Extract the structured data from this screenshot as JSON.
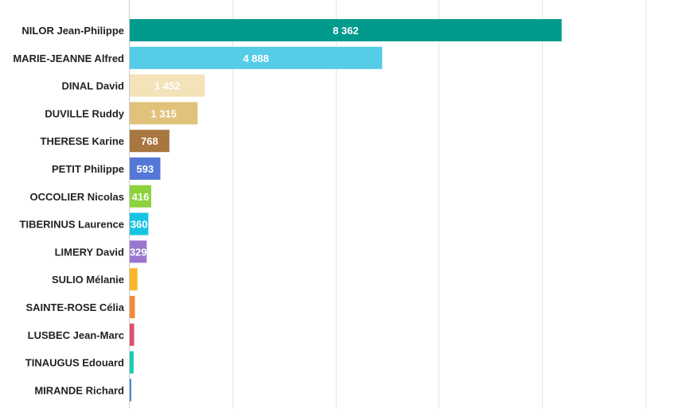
{
  "chart_data": {
    "type": "bar",
    "orientation": "horizontal",
    "title": "",
    "xlabel": "",
    "ylabel": "",
    "xlim": [
      0,
      10000
    ],
    "grid": true,
    "categories": [
      "NILOR Jean-Philippe",
      "MARIE-JEANNE Alfred",
      "DINAL David",
      "DUVILLE Ruddy",
      "THERESE Karine",
      "PETIT Philippe",
      "OCCOLIER Nicolas",
      "TIBERINUS Laurence",
      "LIMERY David",
      "SULIO Mélanie",
      "SAINTE-ROSE Célia",
      "LUSBEC Jean-Marc",
      "TINAUGUS Edouard",
      "MIRANDE Richard"
    ],
    "values": [
      8362,
      4888,
      1452,
      1315,
      768,
      593,
      416,
      360,
      329,
      150,
      100,
      85,
      75,
      30
    ],
    "data_labels": [
      "8 362",
      "4 888",
      "1 452",
      "1 315",
      "768",
      "593",
      "416",
      "360",
      "329",
      "",
      "",
      "",
      "",
      ""
    ],
    "colors": [
      "#009b8d",
      "#56cde8",
      "#f4e2b8",
      "#e0c27b",
      "#a87640",
      "#5577d6",
      "#8cd23c",
      "#16c3e2",
      "#9977cf",
      "#fbb72a",
      "#f28a3a",
      "#e04f6b",
      "#16ccb5",
      "#3b88d6"
    ]
  }
}
